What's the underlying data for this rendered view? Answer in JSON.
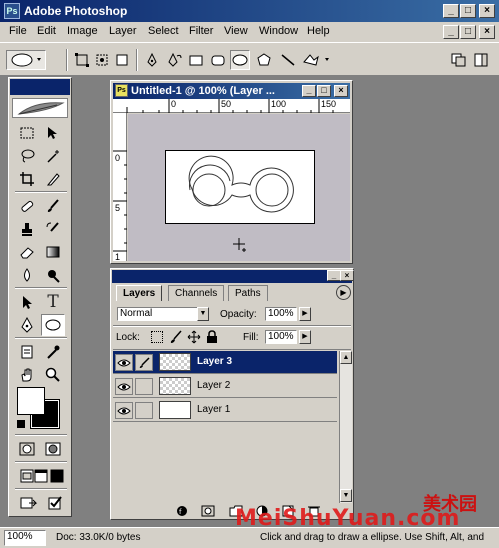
{
  "app": {
    "title": "Adobe Photoshop"
  },
  "menu": [
    "File",
    "Edit",
    "Image",
    "Layer",
    "Select",
    "Filter",
    "View",
    "Window",
    "Help"
  ],
  "document": {
    "title": "Untitled-1 @ 100% (Layer ...",
    "ruler_h": [
      "0",
      "50",
      "100",
      "150"
    ],
    "ruler_v": [
      "0",
      "5",
      "1"
    ]
  },
  "layers_panel": {
    "tabs": [
      "Layers",
      "Channels",
      "Paths"
    ],
    "blend_mode": "Normal",
    "opacity_label": "Opacity:",
    "opacity": "100%",
    "lock_label": "Lock:",
    "fill_label": "Fill:",
    "fill": "100%",
    "layers": [
      {
        "name": "Layer 3",
        "selected": true
      },
      {
        "name": "Layer 2",
        "selected": false
      },
      {
        "name": "Layer 1",
        "selected": false
      }
    ]
  },
  "status": {
    "zoom": "100%",
    "doc": "Doc: 33.0K/0 bytes",
    "message": "Click and drag to draw a ellipse. Use Shift, Alt, and"
  },
  "watermark": {
    "cn": "美术园",
    "en": "MeiShuYuan.com"
  },
  "colors": {
    "title_blue": "#0a246a",
    "face": "#d4d0c8",
    "workspace": "#808080"
  }
}
